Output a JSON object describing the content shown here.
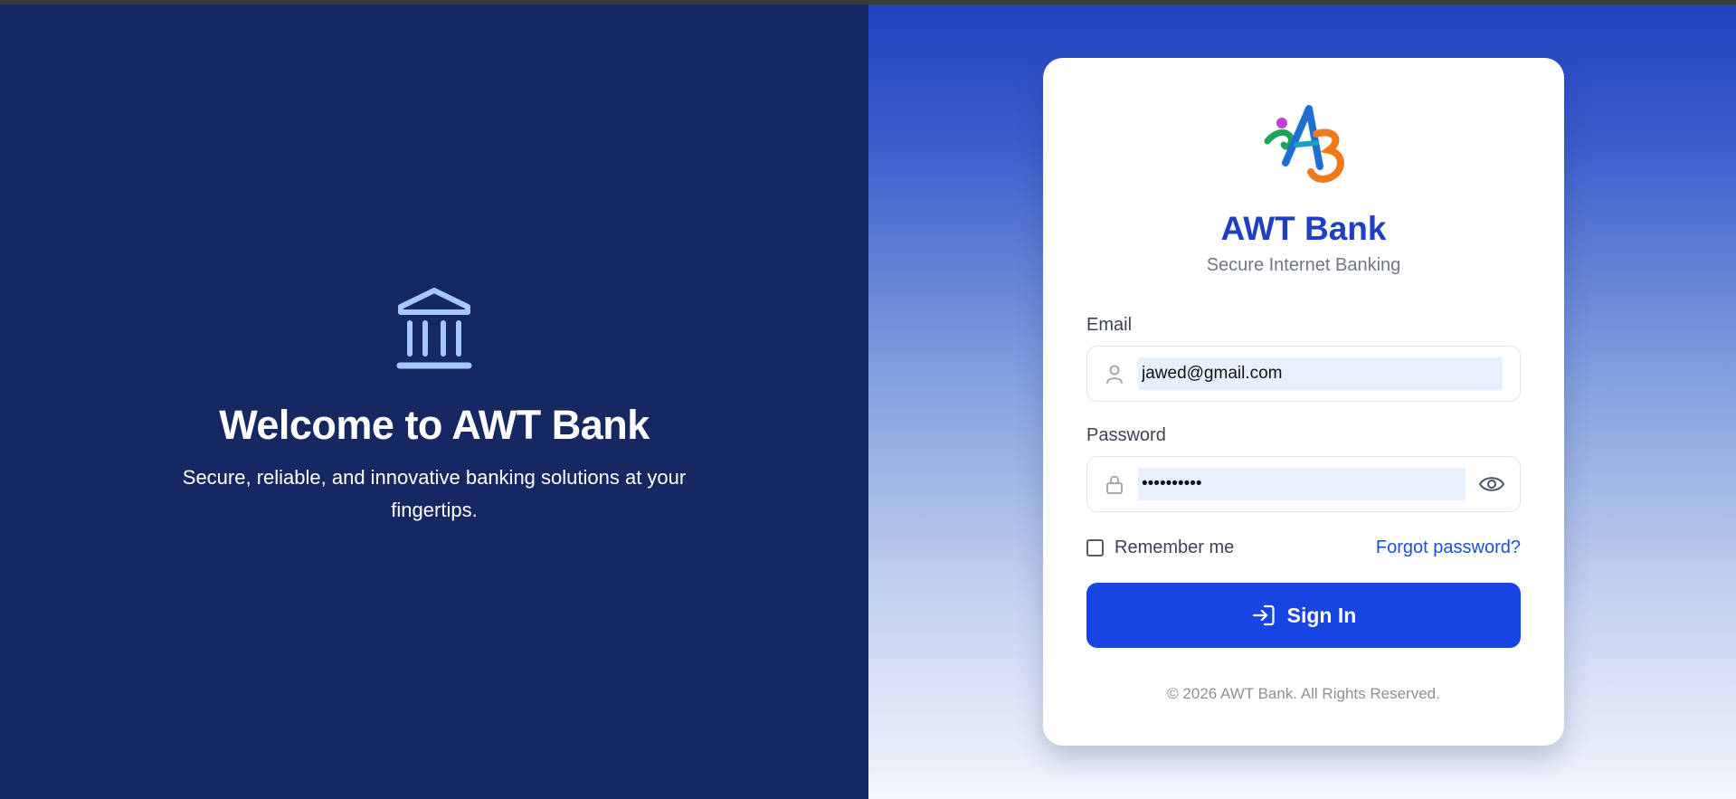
{
  "hero": {
    "icon": "bank-building-icon",
    "title": "Welcome to AWT Bank",
    "subtitle": "Secure, reliable, and innovative banking solutions at your fingertips."
  },
  "card": {
    "logo": "awt-bank-logo",
    "brand_name": "AWT Bank",
    "brand_subtitle": "Secure Internet Banking",
    "email": {
      "label": "Email",
      "icon": "user-icon",
      "value": "jawed@gmail.com"
    },
    "password": {
      "label": "Password",
      "icon": "lock-icon",
      "value": "••••••••••",
      "toggle_icon": "eye-icon"
    },
    "remember_label": "Remember me",
    "remember_checked": false,
    "forgot_label": "Forgot password?",
    "signin_label": "Sign In",
    "signin_icon": "sign-in-icon",
    "footer": "© 2026 AWT Bank. All Rights Reserved."
  },
  "colors": {
    "left_panel": "#152862",
    "brand": "#1e3fbf",
    "button": "#1745e2",
    "link": "#1e4fd9",
    "autofill": "#e8f0fe"
  }
}
